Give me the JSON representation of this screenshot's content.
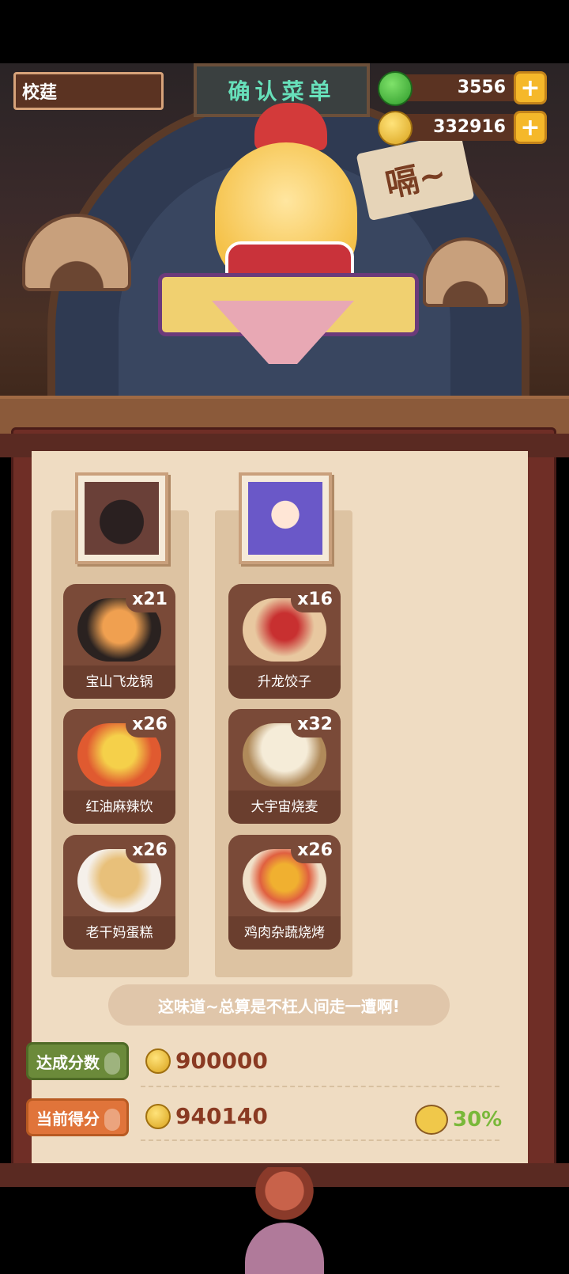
{
  "header": {
    "player_name": "校莛",
    "sign_text": "确认菜单",
    "jade": {
      "value": "3556",
      "icon": "jade-icon"
    },
    "coins": {
      "value": "332916",
      "icon": "coin-icon"
    }
  },
  "scene": {
    "speech": "嗝~"
  },
  "columns": [
    {
      "portrait": "wolf-portrait",
      "dishes": [
        {
          "name": "宝山飞龙锅",
          "count": "x21"
        },
        {
          "name": "红油麻辣饮",
          "count": "x26"
        },
        {
          "name": "老干妈蛋糕",
          "count": "x26"
        }
      ]
    },
    {
      "portrait": "girl-portrait",
      "dishes": [
        {
          "name": "升龙饺子",
          "count": "x16"
        },
        {
          "name": "大宇宙烧麦",
          "count": "x32"
        },
        {
          "name": "鸡肉杂蔬烧烤",
          "count": "x26"
        }
      ]
    }
  ],
  "quote": "这味道~总算是不枉人间走一遭啊!",
  "target": {
    "label": "达成分数",
    "value": "900000"
  },
  "current": {
    "label": "当前得分",
    "value": "940140",
    "bonus": "30%"
  },
  "colors": {
    "accent_green": "#7ab83a",
    "score_text": "#8a3a22"
  }
}
